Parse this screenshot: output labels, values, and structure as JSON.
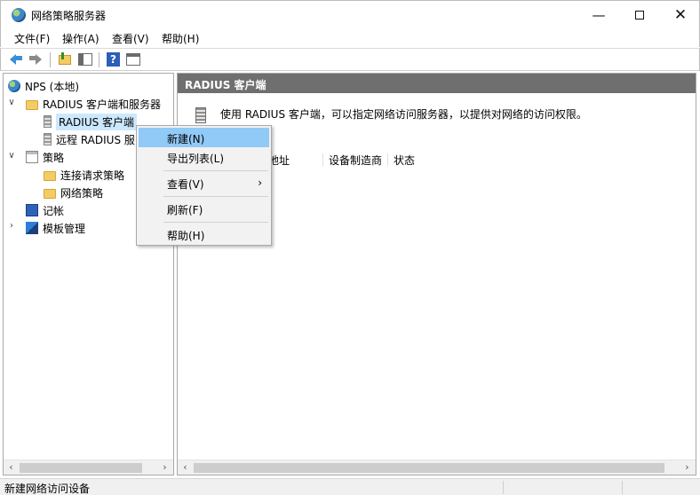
{
  "window": {
    "title": "网络策略服务器",
    "controls": {
      "minimize": "—",
      "close": "✕"
    }
  },
  "menubar": {
    "items": [
      "文件(F)",
      "操作(A)",
      "查看(V)",
      "帮助(H)"
    ]
  },
  "toolbar": {
    "icons": [
      "back-icon",
      "forward-icon",
      "up-folder-icon",
      "show-hide-tree-icon",
      "help-icon",
      "console-icon"
    ],
    "help_glyph": "?"
  },
  "tree": {
    "root": "NPS (本地)",
    "radius_group": "RADIUS 客户端和服务器",
    "radius_clients": "RADIUS 客户端",
    "remote_radius": "远程 RADIUS 服",
    "policies": "策略",
    "connection_request": "连接请求策略",
    "network_policies": "网络策略",
    "accounting": "记帐",
    "templates": "模板管理",
    "expanded_glyph": "∨",
    "collapsed_glyph": "›"
  },
  "main": {
    "header": "RADIUS 客户端",
    "info_text": "使用 RADIUS 客户端，可以指定网络访问服务器，以提供对网络的访问权限。",
    "columns": [
      "地址",
      "设备制造商",
      "状态"
    ]
  },
  "context_menu": {
    "items": [
      {
        "label": "新建(N)",
        "highlighted": true
      },
      {
        "label": "导出列表(L)"
      },
      {
        "label": "查看(V)",
        "submenu_arrow": "›"
      },
      {
        "label": "刷新(F)"
      },
      {
        "label": "帮助(H)"
      }
    ]
  },
  "scrollbars": {
    "left_arrow": "‹",
    "right_arrow": "›"
  },
  "status": {
    "text": "新建网络访问设备"
  }
}
